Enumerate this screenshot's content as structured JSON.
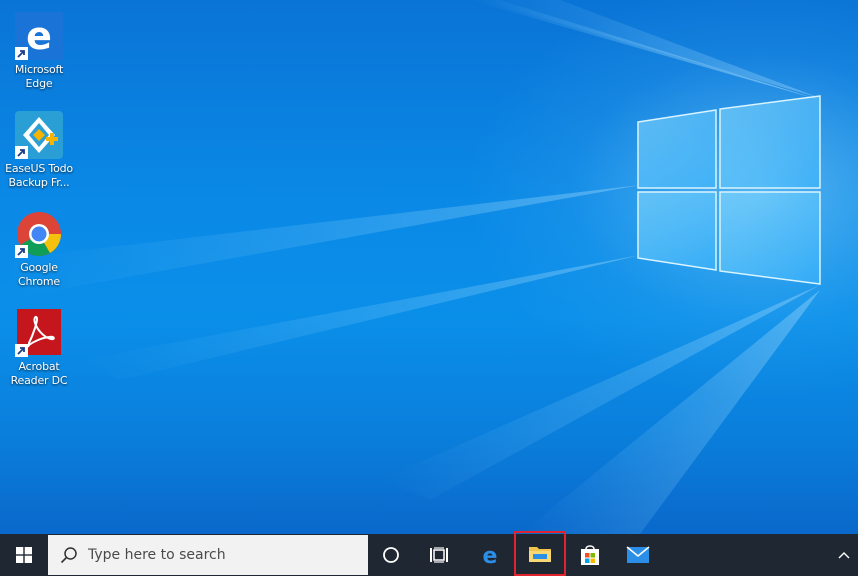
{
  "desktop": {
    "icons": [
      {
        "label": "Microsoft\nEdge",
        "icon": "edge-icon"
      },
      {
        "label": "EaseUS Todo\nBackup Fr...",
        "icon": "easeus-todo-backup-icon"
      },
      {
        "label": "Google\nChrome",
        "icon": "chrome-icon"
      },
      {
        "label": "Acrobat\nReader DC",
        "icon": "acrobat-reader-icon"
      }
    ],
    "wallpaper": "windows-10-hero",
    "colors": {
      "accent": "#0a89e6",
      "highlight": "#e0242f",
      "taskbar": "#1f2733"
    }
  },
  "taskbar": {
    "search_placeholder": "Type here to search",
    "start_icon": "windows-start-icon",
    "cortana_icon": "cortana-circle-icon",
    "taskview_icon": "task-view-icon",
    "pinned": [
      {
        "name": "Microsoft Edge",
        "icon": "edge-icon"
      },
      {
        "name": "File Explorer",
        "icon": "folder-icon",
        "highlighted": true
      },
      {
        "name": "Microsoft Store",
        "icon": "store-bag-icon"
      },
      {
        "name": "Mail",
        "icon": "mail-icon"
      }
    ],
    "tray_icon": "chevron-up-icon"
  }
}
